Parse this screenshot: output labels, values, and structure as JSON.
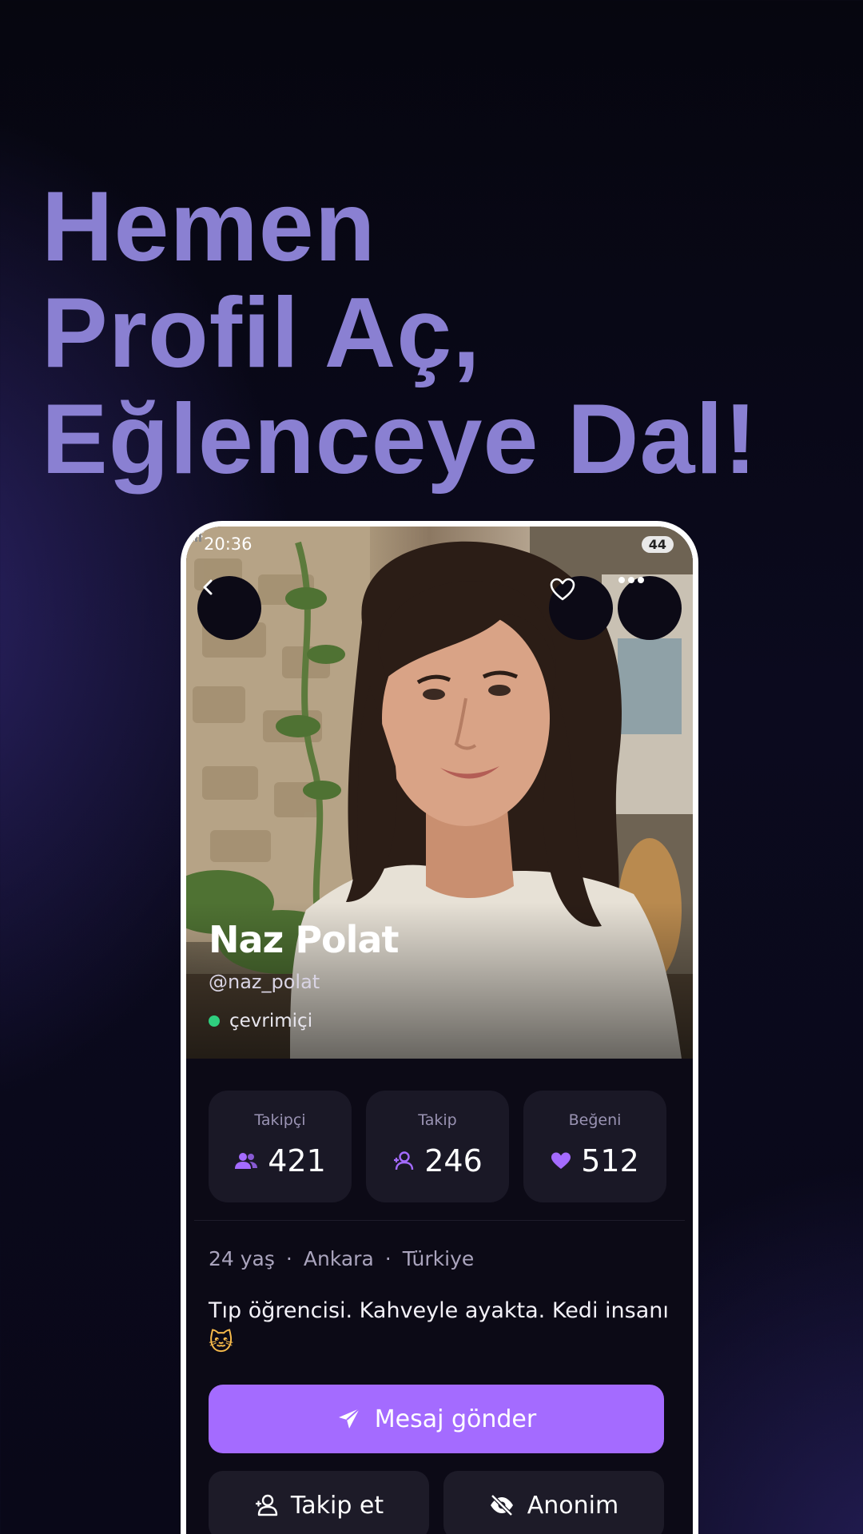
{
  "headline": {
    "line1": "Hemen",
    "line2": "Profil Aç,",
    "line3": "Eğlenceye Dal!"
  },
  "status_bar": {
    "time": "20:36",
    "icons": [
      "mute-icon",
      "wifi-icon",
      "signal-icon"
    ],
    "battery": "44"
  },
  "profile": {
    "name": "Naz Polat",
    "handle": "@naz_polat",
    "status": "çevrimiçi"
  },
  "stats": [
    {
      "label": "Takipçi",
      "value": "421",
      "icon": "followers-icon"
    },
    {
      "label": "Takip",
      "value": "246",
      "icon": "following-icon"
    },
    {
      "label": "Beğeni",
      "value": "512",
      "icon": "heart-icon"
    }
  ],
  "meta": {
    "age": "24 yaş",
    "separator": "·",
    "city": "Ankara",
    "country": "Türkiye"
  },
  "bio": {
    "text": "Tıp öğrencisi. Kahveyle ayakta. Kedi insanı",
    "emoji": "🐱"
  },
  "actions": {
    "message": "Mesaj gönder",
    "follow": "Takip et",
    "anonymous": "Anonim"
  },
  "colors": {
    "headline": "#8a80d2",
    "accent": "#a46bff",
    "online": "#2fcf7f",
    "card": "#1a1826",
    "background": "#0c0a16"
  }
}
